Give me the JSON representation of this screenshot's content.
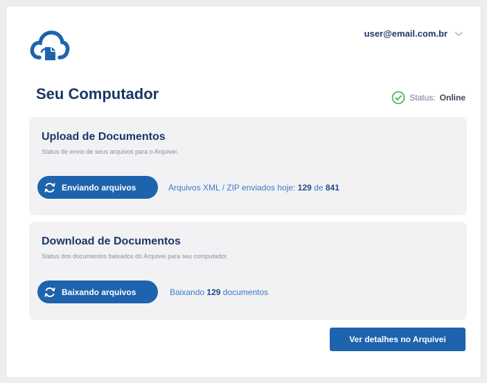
{
  "header": {
    "user_email": "user@email.com.br"
  },
  "main": {
    "title": "Seu Computador",
    "status_label": "Status:",
    "status_value": "Online"
  },
  "upload": {
    "title": "Upload de Documentos",
    "subtitle": "Status de envio de seus arquivos para o Arquivei.",
    "button_label": "Enviando arquivos",
    "info_prefix": "Arquivos XML / ZIP enviados hoje:",
    "sent_count": "129",
    "info_joiner": "de",
    "total_count": "841"
  },
  "download": {
    "title": "Download de Documentos",
    "subtitle": "Status dos documentos baixados do Arquivei para seu computador.",
    "button_label": "Baixando arquivos",
    "info_prefix": "Baixando",
    "count": "129",
    "info_suffix": "documentos"
  },
  "footer": {
    "details_button_label": "Ver detalhes no Arquivei"
  },
  "colors": {
    "primary": "#1e63ad",
    "title": "#1a3766",
    "link": "#3a79c4",
    "success": "#3fae49",
    "card_bg": "#f2f2f4"
  },
  "icons": {
    "logo": "cloud-document-logo-icon",
    "user_menu": "chevron-down-icon",
    "status": "check-circle-icon",
    "sync": "refresh-icon"
  }
}
